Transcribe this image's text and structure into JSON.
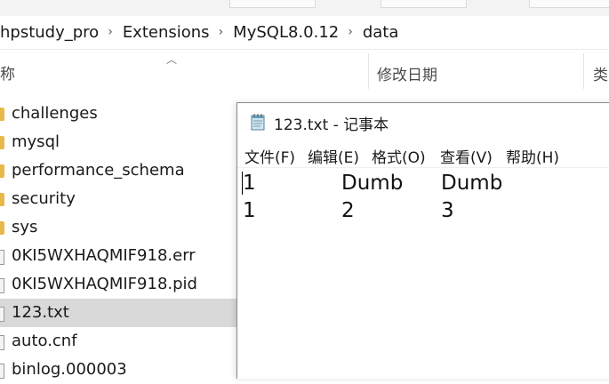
{
  "breadcrumb": [
    "hpstudy_pro",
    "Extensions",
    "MySQL8.0.12",
    "data"
  ],
  "breadcrumb_separator": "›",
  "columns": {
    "name_partial": "称",
    "date": "修改日期",
    "type_partial": "类"
  },
  "files": [
    {
      "name": "challenges",
      "kind": "folder"
    },
    {
      "name": "mysql",
      "kind": "folder"
    },
    {
      "name": "performance_schema",
      "kind": "folder"
    },
    {
      "name": "security",
      "kind": "folder"
    },
    {
      "name": "sys",
      "kind": "folder"
    },
    {
      "name": "0KI5WXHAQMIF918.err",
      "kind": "file"
    },
    {
      "name": "0KI5WXHAQMIF918.pid",
      "kind": "file"
    },
    {
      "name": "123.txt",
      "kind": "file",
      "selected": true
    },
    {
      "name": "auto.cnf",
      "kind": "file"
    },
    {
      "name": "binlog.000003",
      "kind": "file"
    }
  ],
  "notepad": {
    "title": "123.txt - 记事本",
    "menu": [
      "文件(F)",
      "编辑(E)",
      "格式(O)",
      "查看(V)",
      "帮助(H)"
    ],
    "lines": [
      [
        "1",
        "Dumb",
        "Dumb"
      ],
      [
        "1",
        "2",
        "3"
      ]
    ]
  },
  "colors": {
    "selected_row": "#d9d9d9",
    "folder": "#e8b84a"
  }
}
